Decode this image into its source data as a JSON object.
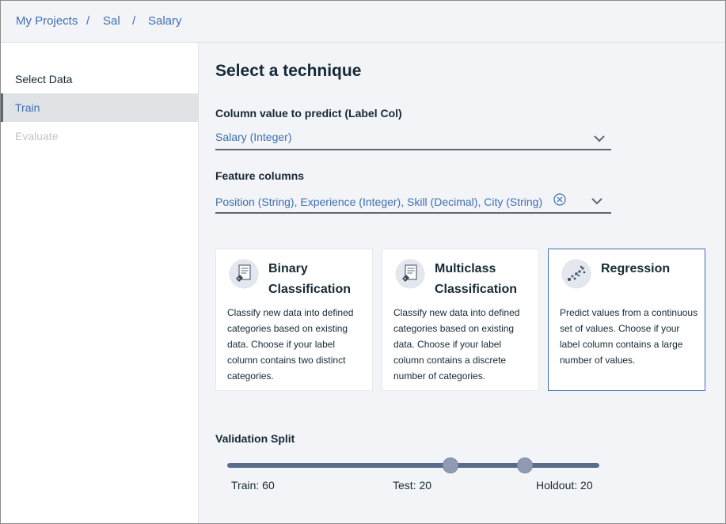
{
  "breadcrumb": [
    {
      "label": "My Projects"
    },
    {
      "label": "Sal"
    },
    {
      "label": "Salary"
    }
  ],
  "breadcrumb_separator": "/",
  "sidebar": {
    "items": [
      {
        "label": "Select Data",
        "state": "normal"
      },
      {
        "label": "Train",
        "state": "active"
      },
      {
        "label": "Evaluate",
        "state": "disabled"
      }
    ]
  },
  "main": {
    "title": "Select a technique",
    "label_col": {
      "label": "Column value to predict (Label Col)",
      "value": "Salary (Integer)"
    },
    "feature_cols": {
      "label": "Feature columns",
      "value": "Position (String), Experience (Integer), Skill (Decimal), City (String)"
    },
    "techniques": [
      {
        "title": "Binary Classification",
        "description": "Classify new data into defined categories based on existing data. Choose if your label column contains two distinct categories.",
        "icon": "document-tag-icon",
        "selected": false
      },
      {
        "title": "Multiclass Classification",
        "description": "Classify new data into defined categories based on existing data. Choose if your label column contains a discrete number of categories.",
        "icon": "document-tag-icon",
        "selected": false
      },
      {
        "title": "Regression",
        "description": "Predict values from a continuous set of values. Choose if your label column contains a large number of values.",
        "icon": "scatter-dots-icon",
        "selected": true
      }
    ],
    "validation": {
      "label": "Validation Split",
      "train": "Train: 60",
      "test": "Test: 20",
      "holdout": "Holdout: 20",
      "train_pct": 60,
      "test_pct": 20,
      "holdout_pct": 20
    }
  },
  "colors": {
    "accent": "#3d70b2",
    "text": "#152935",
    "background": "#f3f4f8",
    "slider_track": "#5a6c8c"
  }
}
